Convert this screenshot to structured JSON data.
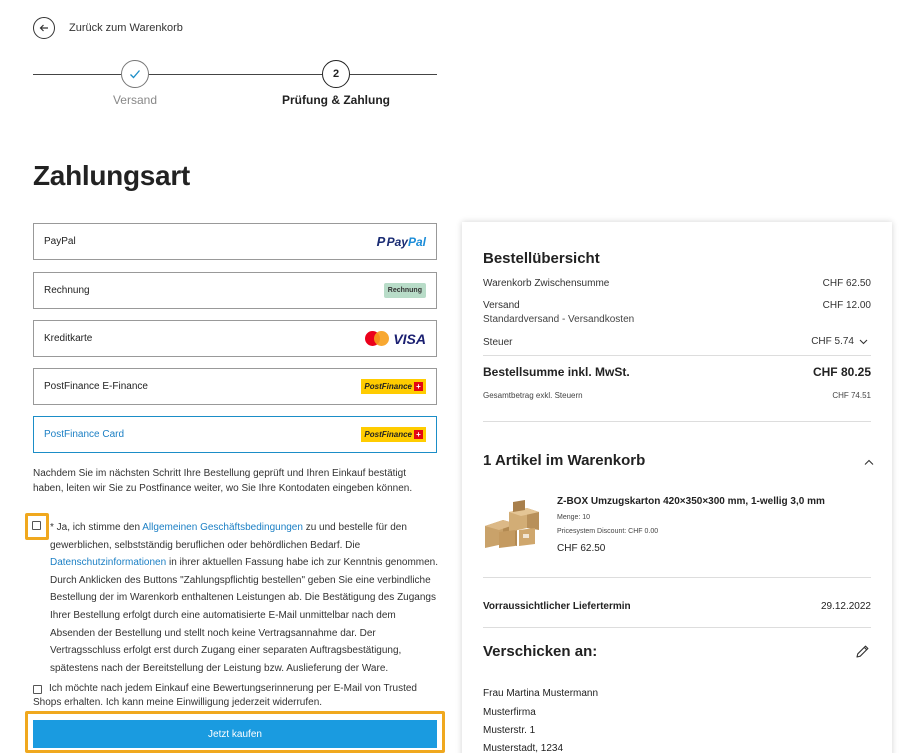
{
  "nav": {
    "back_label": "Zurück zum Warenkorb"
  },
  "stepper": {
    "steps": [
      {
        "label": "Versand",
        "state": "done"
      },
      {
        "label": "Prüfung & Zahlung",
        "number": "2",
        "state": "active"
      }
    ]
  },
  "page_title": "Zahlungsart",
  "payment_methods": [
    {
      "label": "PayPal",
      "logo": "paypal-logo",
      "logo_text_1": "Pay",
      "logo_text_2": "Pal"
    },
    {
      "label": "Rechnung",
      "logo": "rechnung-badge",
      "logo_text": "Rechnung"
    },
    {
      "label": "Kreditkarte",
      "logo": "mastercard-visa-logos",
      "logo_text": "VISA"
    },
    {
      "label": "PostFinance E-Finance",
      "logo": "postfinance-logo",
      "logo_text": "PostFinance"
    },
    {
      "label": "PostFinance Card",
      "logo": "postfinance-logo",
      "logo_text": "PostFinance",
      "selected": true
    }
  ],
  "info_text": "Nachdem Sie im nächsten Schritt Ihre Bestellung geprüft und Ihren Einkauf bestätigt haben, leiten wir Sie zu Postfinance weiter, wo Sie Ihre Kontodaten eingeben können.",
  "agb": {
    "part1": "* Ja, ich stimme den ",
    "link1": "Allgemeinen Geschäftsbedingungen",
    "part2": " zu und bestelle für den gewerblichen, selbstständig beruflichen oder behördlichen Bedarf. Die ",
    "link2": "Datenschutzinformationen",
    "part3": " in ihrer aktuellen Fassung habe ich zur Kenntnis genommen. Durch Anklicken des Buttons \"Zahlungspflichtig bestellen\" geben Sie eine verbindliche Bestellung der im Warenkorb enthaltenen Leistungen ab. Die Bestätigung des Zugangs Ihrer Bestellung erfolgt durch eine automatisierte E-Mail unmittelbar nach dem Absenden der Bestellung und stellt noch keine Vertragsannahme dar. Der Vertragsschluss erfolgt erst durch Zugang einer separaten Auftragsbestätigung, spätestens nach der Bereitstellung der Leistung bzw. Auslieferung der Ware."
  },
  "trusted_shops_text": "Ich möchte nach jedem Einkauf eine Bewertungserinnerung per E-Mail von Trusted Shops erhalten. Ich kann meine Einwilligung jederzeit widerrufen.",
  "buy_button": "Jetzt kaufen",
  "summary": {
    "title": "Bestellübersicht",
    "subtotal_label": "Warenkorb Zwischensumme",
    "subtotal_value": "CHF 62.50",
    "shipping_label": "Versand",
    "shipping_sub": "Standardversand - Versandkosten",
    "shipping_value": "CHF 12.00",
    "tax_label": "Steuer",
    "tax_value": "CHF 5.74",
    "total_label": "Bestellsumme inkl. MwSt.",
    "total_value": "CHF 80.25",
    "net_label": "Gesamtbetrag exkl. Steuern",
    "net_value": "CHF 74.51"
  },
  "cart": {
    "title": "1 Artikel im Warenkorb",
    "item": {
      "name": "Z-BOX Umzugskarton 420×350×300 mm, 1-wellig 3,0 mm",
      "quantity": "Menge: 10",
      "discount": "Pricesystem Discount: CHF 0.00",
      "price": "CHF 62.50"
    },
    "delivery_label": "Vorraussichtlicher Liefertermin",
    "delivery_value": "29.12.2022"
  },
  "shipping_address": {
    "title": "Verschicken an:",
    "lines": [
      "Frau Martina Mustermann",
      "Musterfirma",
      "Musterstr. 1",
      "Musterstadt, 1234"
    ]
  }
}
